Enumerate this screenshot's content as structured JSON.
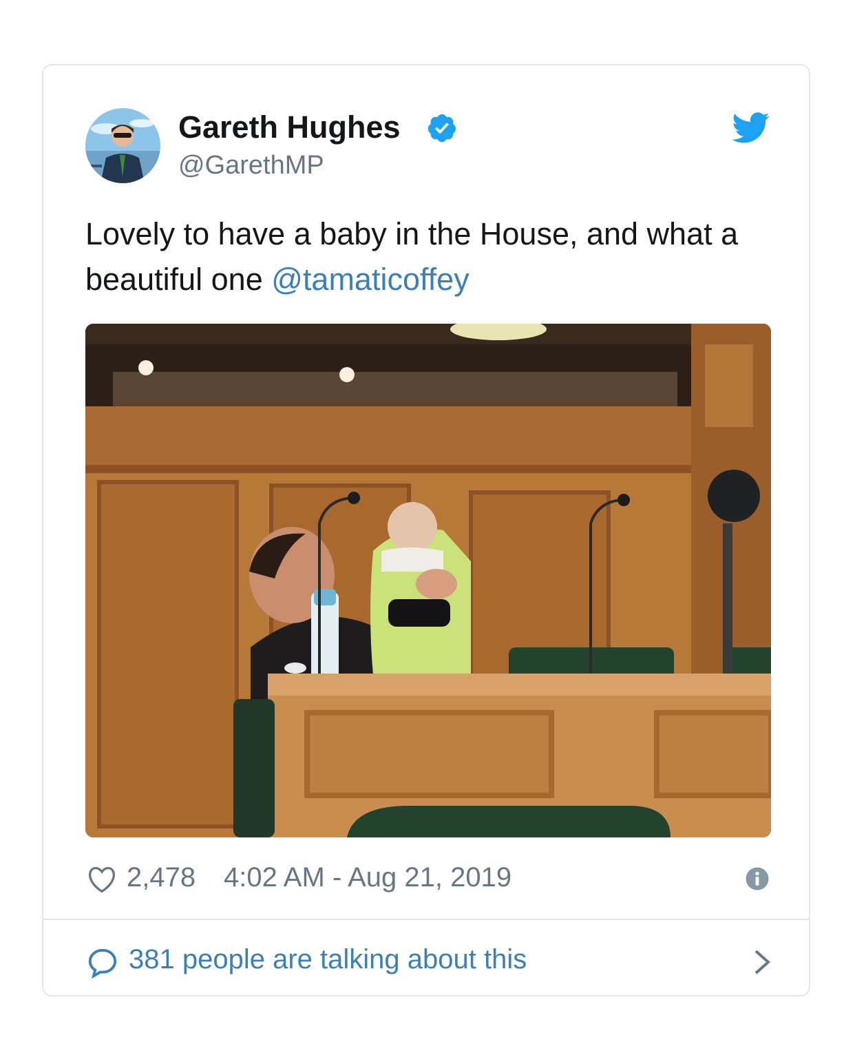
{
  "author": {
    "display_name": "Gareth Hughes",
    "handle": "@GarethMP",
    "verified": true
  },
  "tweet": {
    "text_before_mention": "Lovely to have a baby in the House, and what a beautiful one ",
    "mention": "@tamaticoffey"
  },
  "stats": {
    "likes": "2,478",
    "timestamp": "4:02 AM - Aug 21, 2019"
  },
  "footer": {
    "talking_label": "381 people are talking about this"
  },
  "icons": {
    "verified": "verified-badge-icon",
    "brand": "twitter-bird-icon",
    "like": "heart-icon",
    "info": "info-icon",
    "reply": "speech-bubble-icon",
    "more": "chevron-right-icon"
  },
  "colors": {
    "text": "#14171a",
    "secondary": "#657786",
    "link": "#3b7fb8",
    "twitter_blue": "#1da1f2",
    "border": "#e1e8ed"
  }
}
